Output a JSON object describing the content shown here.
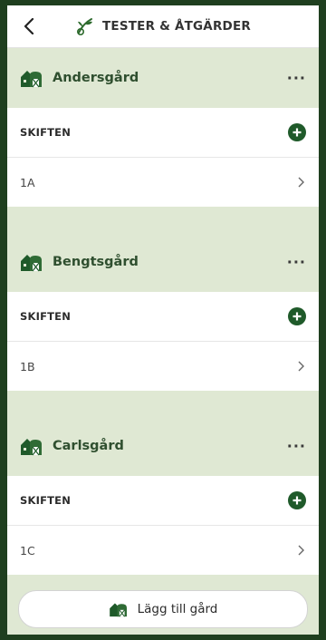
{
  "header": {
    "title": "TESTER & ÅTGÄRDER",
    "back_icon": "chevron-left-icon",
    "logo_icon": "plant-test-icon"
  },
  "farms": [
    {
      "name": "Andersgård",
      "section_label": "SKIFTEN",
      "fields": [
        "1A"
      ]
    },
    {
      "name": "Bengtsgård",
      "section_label": "SKIFTEN",
      "fields": [
        "1B"
      ]
    },
    {
      "name": "Carlsgård",
      "section_label": "SKIFTEN",
      "fields": [
        "1C"
      ]
    }
  ],
  "menu_label": "···",
  "add_farm": {
    "label": "Lägg till gård",
    "icon": "farm-icon"
  },
  "colors": {
    "accent": "#1f5a2a",
    "background": "#dfe8d3",
    "outer": "#1f3f1f"
  }
}
